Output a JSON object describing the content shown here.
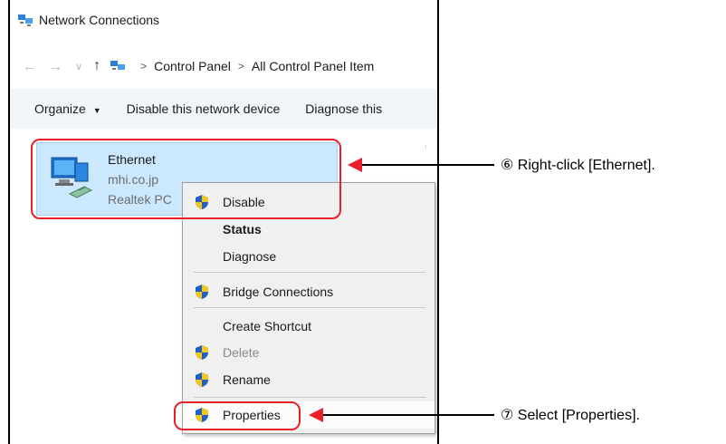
{
  "window": {
    "title": "Network Connections",
    "breadcrumb": [
      "Control Panel",
      "All Control Panel Item"
    ]
  },
  "commandbar": {
    "organize": "Organize",
    "disable": "Disable this network device",
    "diagnose": "Diagnose this"
  },
  "connection": {
    "name": "Ethernet",
    "domain": "mhi.co.jp",
    "device": "Realtek PC"
  },
  "context_menu": {
    "items": [
      {
        "label": "Disable",
        "shield": true
      },
      {
        "label": "Status",
        "bold": true
      },
      {
        "label": "Diagnose"
      },
      {
        "label": "Bridge Connections",
        "shield": true
      },
      {
        "label": "Create Shortcut"
      },
      {
        "label": "Delete",
        "shield": true,
        "disabled": true
      },
      {
        "label": "Rename",
        "shield": true
      },
      {
        "label": "Properties",
        "shield": true,
        "highlighted": true
      }
    ]
  },
  "annotations": {
    "step6": "⑥ Right-click [Ethernet].",
    "step7": "⑦ Select [Properties]."
  },
  "colors": {
    "callout": "#e8202a",
    "selection": "#cce8ff",
    "commandbar": "#f3f6f9"
  }
}
